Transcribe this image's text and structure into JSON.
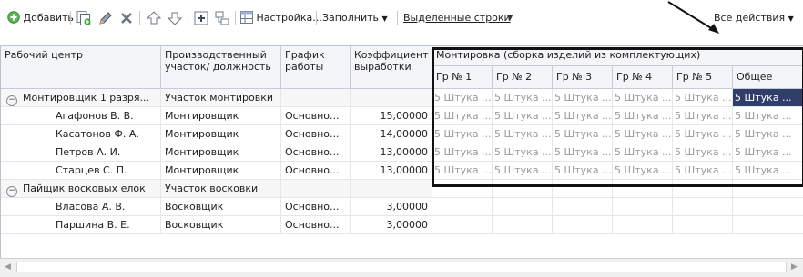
{
  "toolbar": {
    "add_label": "Добавить",
    "settings_label": "Настройка...",
    "fill_label": "Заполнить",
    "selected_rows_label": "Выделенные строки",
    "all_actions_label": "Все действия"
  },
  "columns": {
    "work_center": "Рабочий центр",
    "site_position": "Производственный участок/ должность",
    "schedule": "График работы",
    "coefficient": "Коэффициент выработки",
    "group_header": "Монтировка (сборка изделий из комплектующих)",
    "sub": [
      "Гр № 1",
      "Гр № 2",
      "Гр № 3",
      "Гр № 4",
      "Гр № 5",
      "Общее"
    ]
  },
  "rows": [
    {
      "type": "group",
      "name": "Монтировщик 1 разря...",
      "site": "Участок монтировки",
      "schedule": "",
      "coef": "",
      "cells": [
        "5 Штука ...",
        "5 Штука ...",
        "5 Штука ...",
        "5 Штука ...",
        "5 Штука ...",
        "5 Штука ..."
      ]
    },
    {
      "type": "item",
      "name": "Агафонов В. В.",
      "site": "Монтировщик",
      "schedule": "Основно...",
      "coef": "15,00000",
      "cells": [
        "5 Штука ...",
        "5 Штука ...",
        "5 Штука ...",
        "5 Штука ...",
        "5 Штука ...",
        "5 Штука ..."
      ]
    },
    {
      "type": "item",
      "name": "Касатонов Ф. А.",
      "site": "Монтировщик",
      "schedule": "Основно...",
      "coef": "14,00000",
      "cells": [
        "5 Штука ...",
        "5 Штука ...",
        "5 Штука ...",
        "5 Штука ...",
        "5 Штука ...",
        "5 Штука ..."
      ]
    },
    {
      "type": "item",
      "name": "Петров А. И.",
      "site": "Монтировщик",
      "schedule": "Основно...",
      "coef": "13,00000",
      "cells": [
        "5 Штука ...",
        "5 Штука ...",
        "5 Штука ...",
        "5 Штука ...",
        "5 Штука ...",
        "5 Штука ..."
      ]
    },
    {
      "type": "item",
      "name": "Старцев С. П.",
      "site": "Монтировщик",
      "schedule": "Основно...",
      "coef": "13,00000",
      "cells": [
        "5 Штука ...",
        "5 Штука ...",
        "5 Штука ...",
        "5 Штука ...",
        "5 Штука ...",
        "5 Штука ..."
      ]
    },
    {
      "type": "group",
      "name": "Пайщик восковых елок",
      "site": "Участок восковки",
      "schedule": "",
      "coef": "",
      "cells": [
        "",
        "",
        "",
        "",
        "",
        ""
      ]
    },
    {
      "type": "item",
      "name": "Власова А. В.",
      "site": "Восковщик",
      "schedule": "Основно...",
      "coef": "3,00000",
      "cells": [
        "",
        "",
        "",
        "",
        "",
        ""
      ]
    },
    {
      "type": "item",
      "name": "Паршина В. Е.",
      "site": "Восковщик",
      "schedule": "Основно...",
      "coef": "3,00000",
      "cells": [
        "",
        "",
        "",
        "",
        "",
        ""
      ]
    }
  ],
  "icons": {
    "add": "plus-circle-icon",
    "copy": "copy-icon",
    "edit": "pencil-icon",
    "delete": "delete-x-icon",
    "up": "move-up-icon",
    "down": "move-down-icon",
    "collapse": "tree-collapse-icon",
    "expand": "tree-expand-icon",
    "settings": "settings-grid-icon",
    "group_toggle": "minus-circle-icon"
  },
  "colors": {
    "selected_cell": "#2f3f6a",
    "highlight_border": "#111111",
    "accent_green": "#3aa33a"
  }
}
